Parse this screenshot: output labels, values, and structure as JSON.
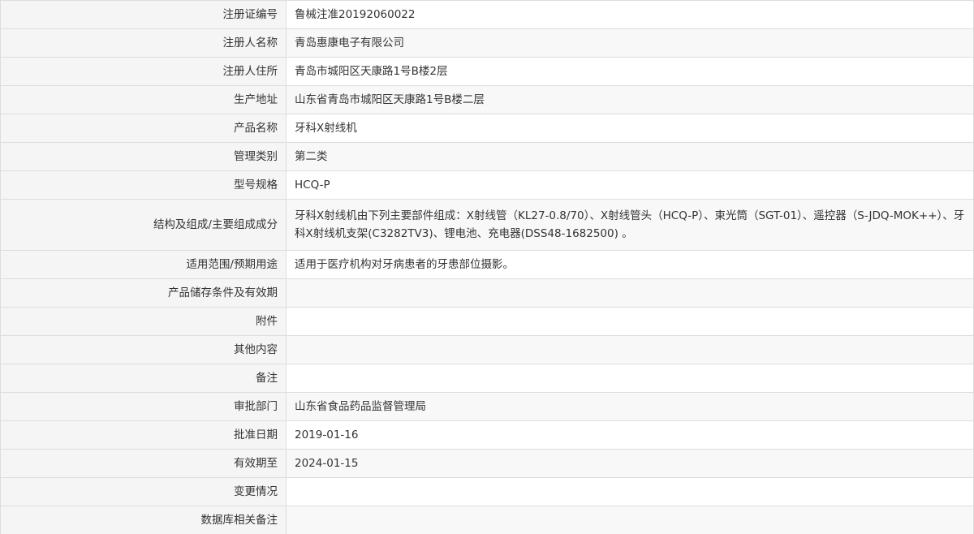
{
  "rows": [
    {
      "label": "注册证编号",
      "value": "鲁械注准20192060022"
    },
    {
      "label": "注册人名称",
      "value": "青岛惠康电子有限公司"
    },
    {
      "label": "注册人住所",
      "value": "青岛市城阳区天康路1号B楼2层"
    },
    {
      "label": "生产地址",
      "value": "山东省青岛市城阳区天康路1号B楼二层"
    },
    {
      "label": "产品名称",
      "value": "牙科X射线机"
    },
    {
      "label": "管理类别",
      "value": "第二类"
    },
    {
      "label": "型号规格",
      "value": "HCQ-P"
    },
    {
      "label": "结构及组成/主要组成成分",
      "value": "牙科X射线机由下列主要部件组成：X射线管（KL27-0.8/70）、X射线管头（HCQ-P）、束光筒（SGT-01）、遥控器（S-JDQ-MOK++）、牙科X射线机支架(C3282TV3)、锂电池、充电器(DSS48-1682500) 。"
    },
    {
      "label": "适用范围/预期用途",
      "value": "适用于医疗机构对牙病患者的牙患部位摄影。"
    },
    {
      "label": "产品储存条件及有效期",
      "value": ""
    },
    {
      "label": "附件",
      "value": ""
    },
    {
      "label": "其他内容",
      "value": ""
    },
    {
      "label": "备注",
      "value": ""
    },
    {
      "label": "审批部门",
      "value": "山东省食品药品监督管理局"
    },
    {
      "label": "批准日期",
      "value": "2019-01-16"
    },
    {
      "label": "有效期至",
      "value": "2024-01-15"
    },
    {
      "label": "变更情况",
      "value": ""
    },
    {
      "label": "数据库相关备注",
      "value": ""
    }
  ]
}
